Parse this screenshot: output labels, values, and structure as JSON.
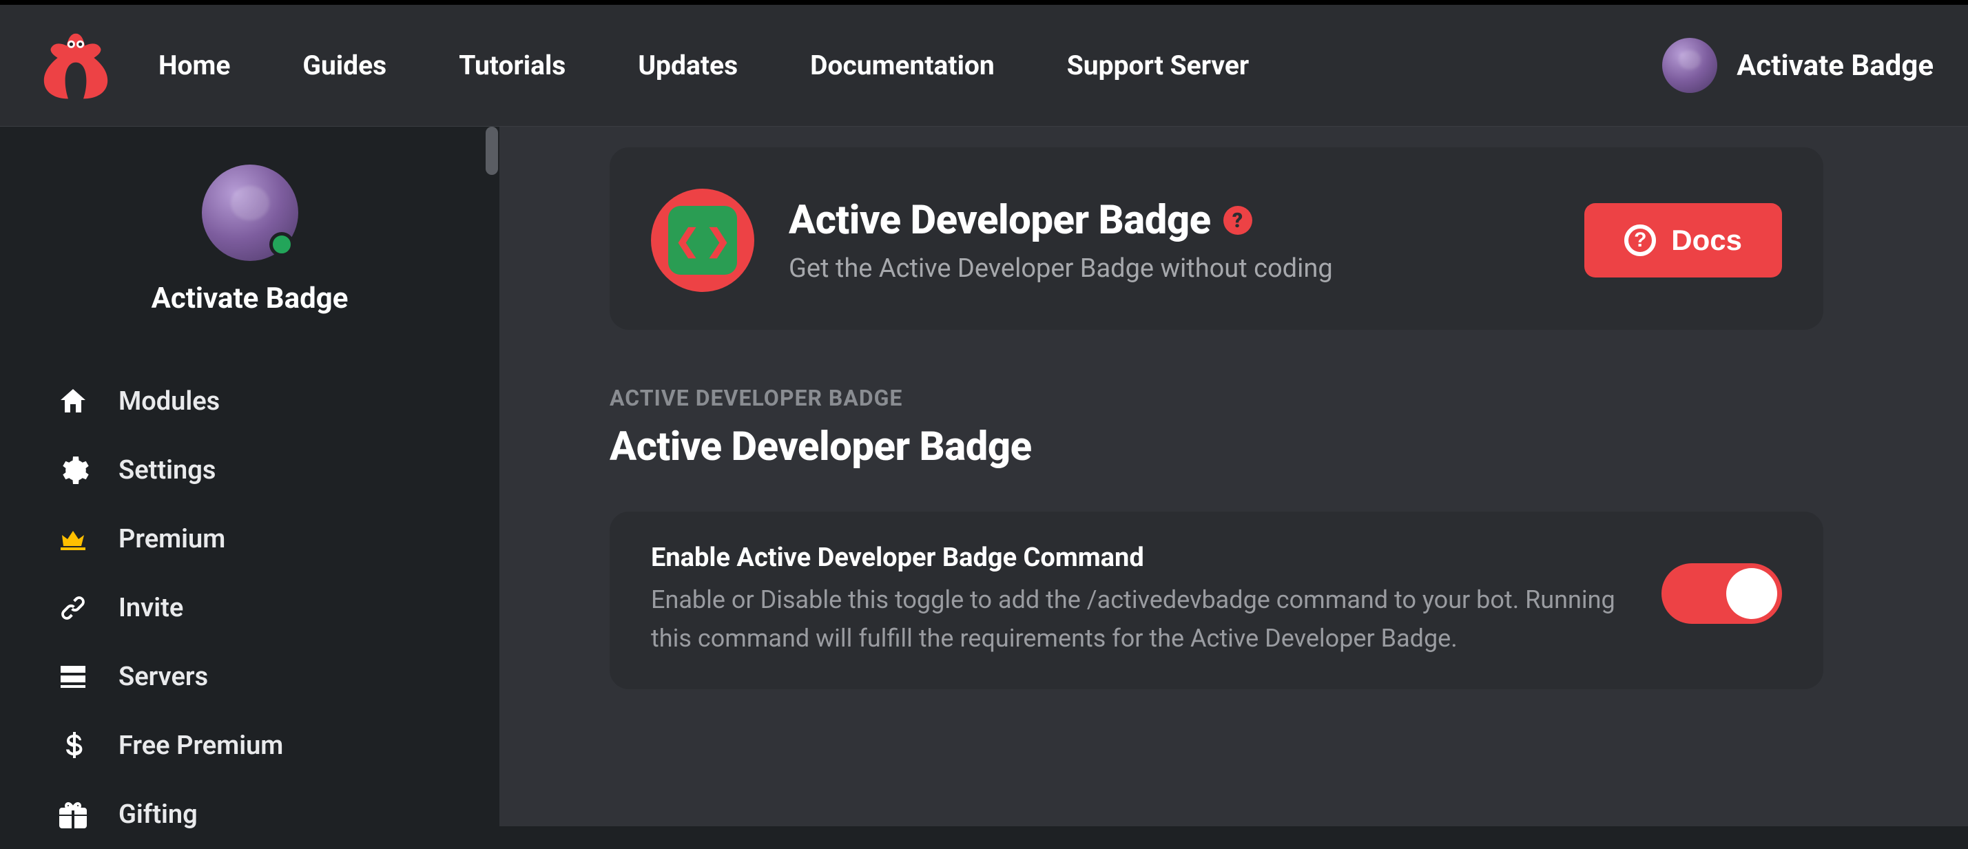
{
  "header": {
    "nav": [
      "Home",
      "Guides",
      "Tutorials",
      "Updates",
      "Documentation",
      "Support Server"
    ],
    "username": "Activate Badge"
  },
  "sidebar": {
    "profile_name": "Activate Badge",
    "items": [
      {
        "label": "Modules"
      },
      {
        "label": "Settings"
      },
      {
        "label": "Premium"
      },
      {
        "label": "Invite"
      },
      {
        "label": "Servers"
      },
      {
        "label": "Free Premium"
      },
      {
        "label": "Gifting"
      }
    ]
  },
  "main": {
    "card": {
      "title": "Active Developer Badge",
      "subtitle": "Get the Active Developer Badge without coding",
      "docs_label": "Docs"
    },
    "section": {
      "eyebrow": "ACTIVE DEVELOPER BADGE",
      "title": "Active Developer Badge"
    },
    "setting": {
      "title": "Enable Active Developer Badge Command",
      "desc": "Enable or Disable this toggle to add the /activedevbadge command to your bot. Running this command will fulfill the requirements for the Active Developer Badge."
    }
  }
}
